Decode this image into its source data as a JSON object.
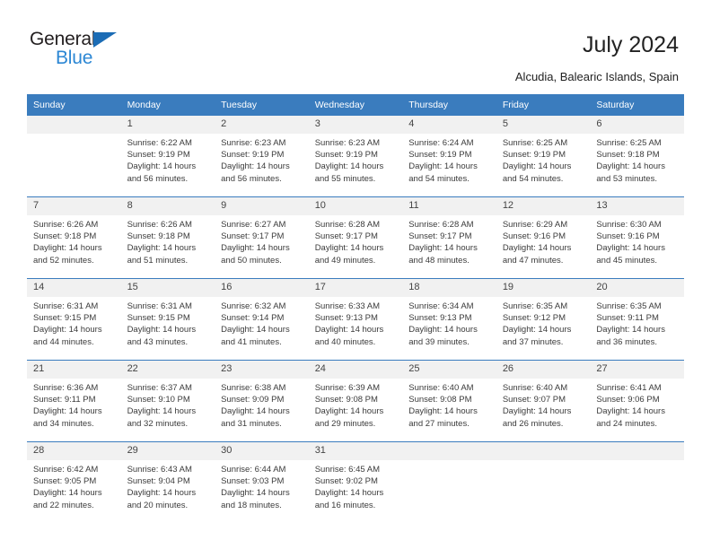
{
  "brand": {
    "name_part1": "General",
    "name_part2": "Blue",
    "accent_color": "#2c87d4",
    "triangle_color": "#1b6cb5"
  },
  "header": {
    "title": "July 2024",
    "location": "Alcudia, Balearic Islands, Spain"
  },
  "calendar": {
    "header_bg": "#3a7cbe",
    "daynum_bg": "#f1f1f1",
    "weekdays": [
      "Sunday",
      "Monday",
      "Tuesday",
      "Wednesday",
      "Thursday",
      "Friday",
      "Saturday"
    ],
    "labels": {
      "sunrise": "Sunrise:",
      "sunset": "Sunset:",
      "daylight": "Daylight:"
    },
    "weeks": [
      [
        {
          "day": "",
          "sunrise": "",
          "sunset": "",
          "daylight_line1": "",
          "daylight_line2": ""
        },
        {
          "day": "1",
          "sunrise": "Sunrise: 6:22 AM",
          "sunset": "Sunset: 9:19 PM",
          "daylight_line1": "Daylight: 14 hours",
          "daylight_line2": "and 56 minutes."
        },
        {
          "day": "2",
          "sunrise": "Sunrise: 6:23 AM",
          "sunset": "Sunset: 9:19 PM",
          "daylight_line1": "Daylight: 14 hours",
          "daylight_line2": "and 56 minutes."
        },
        {
          "day": "3",
          "sunrise": "Sunrise: 6:23 AM",
          "sunset": "Sunset: 9:19 PM",
          "daylight_line1": "Daylight: 14 hours",
          "daylight_line2": "and 55 minutes."
        },
        {
          "day": "4",
          "sunrise": "Sunrise: 6:24 AM",
          "sunset": "Sunset: 9:19 PM",
          "daylight_line1": "Daylight: 14 hours",
          "daylight_line2": "and 54 minutes."
        },
        {
          "day": "5",
          "sunrise": "Sunrise: 6:25 AM",
          "sunset": "Sunset: 9:19 PM",
          "daylight_line1": "Daylight: 14 hours",
          "daylight_line2": "and 54 minutes."
        },
        {
          "day": "6",
          "sunrise": "Sunrise: 6:25 AM",
          "sunset": "Sunset: 9:18 PM",
          "daylight_line1": "Daylight: 14 hours",
          "daylight_line2": "and 53 minutes."
        }
      ],
      [
        {
          "day": "7",
          "sunrise": "Sunrise: 6:26 AM",
          "sunset": "Sunset: 9:18 PM",
          "daylight_line1": "Daylight: 14 hours",
          "daylight_line2": "and 52 minutes."
        },
        {
          "day": "8",
          "sunrise": "Sunrise: 6:26 AM",
          "sunset": "Sunset: 9:18 PM",
          "daylight_line1": "Daylight: 14 hours",
          "daylight_line2": "and 51 minutes."
        },
        {
          "day": "9",
          "sunrise": "Sunrise: 6:27 AM",
          "sunset": "Sunset: 9:17 PM",
          "daylight_line1": "Daylight: 14 hours",
          "daylight_line2": "and 50 minutes."
        },
        {
          "day": "10",
          "sunrise": "Sunrise: 6:28 AM",
          "sunset": "Sunset: 9:17 PM",
          "daylight_line1": "Daylight: 14 hours",
          "daylight_line2": "and 49 minutes."
        },
        {
          "day": "11",
          "sunrise": "Sunrise: 6:28 AM",
          "sunset": "Sunset: 9:17 PM",
          "daylight_line1": "Daylight: 14 hours",
          "daylight_line2": "and 48 minutes."
        },
        {
          "day": "12",
          "sunrise": "Sunrise: 6:29 AM",
          "sunset": "Sunset: 9:16 PM",
          "daylight_line1": "Daylight: 14 hours",
          "daylight_line2": "and 47 minutes."
        },
        {
          "day": "13",
          "sunrise": "Sunrise: 6:30 AM",
          "sunset": "Sunset: 9:16 PM",
          "daylight_line1": "Daylight: 14 hours",
          "daylight_line2": "and 45 minutes."
        }
      ],
      [
        {
          "day": "14",
          "sunrise": "Sunrise: 6:31 AM",
          "sunset": "Sunset: 9:15 PM",
          "daylight_line1": "Daylight: 14 hours",
          "daylight_line2": "and 44 minutes."
        },
        {
          "day": "15",
          "sunrise": "Sunrise: 6:31 AM",
          "sunset": "Sunset: 9:15 PM",
          "daylight_line1": "Daylight: 14 hours",
          "daylight_line2": "and 43 minutes."
        },
        {
          "day": "16",
          "sunrise": "Sunrise: 6:32 AM",
          "sunset": "Sunset: 9:14 PM",
          "daylight_line1": "Daylight: 14 hours",
          "daylight_line2": "and 41 minutes."
        },
        {
          "day": "17",
          "sunrise": "Sunrise: 6:33 AM",
          "sunset": "Sunset: 9:13 PM",
          "daylight_line1": "Daylight: 14 hours",
          "daylight_line2": "and 40 minutes."
        },
        {
          "day": "18",
          "sunrise": "Sunrise: 6:34 AM",
          "sunset": "Sunset: 9:13 PM",
          "daylight_line1": "Daylight: 14 hours",
          "daylight_line2": "and 39 minutes."
        },
        {
          "day": "19",
          "sunrise": "Sunrise: 6:35 AM",
          "sunset": "Sunset: 9:12 PM",
          "daylight_line1": "Daylight: 14 hours",
          "daylight_line2": "and 37 minutes."
        },
        {
          "day": "20",
          "sunrise": "Sunrise: 6:35 AM",
          "sunset": "Sunset: 9:11 PM",
          "daylight_line1": "Daylight: 14 hours",
          "daylight_line2": "and 36 minutes."
        }
      ],
      [
        {
          "day": "21",
          "sunrise": "Sunrise: 6:36 AM",
          "sunset": "Sunset: 9:11 PM",
          "daylight_line1": "Daylight: 14 hours",
          "daylight_line2": "and 34 minutes."
        },
        {
          "day": "22",
          "sunrise": "Sunrise: 6:37 AM",
          "sunset": "Sunset: 9:10 PM",
          "daylight_line1": "Daylight: 14 hours",
          "daylight_line2": "and 32 minutes."
        },
        {
          "day": "23",
          "sunrise": "Sunrise: 6:38 AM",
          "sunset": "Sunset: 9:09 PM",
          "daylight_line1": "Daylight: 14 hours",
          "daylight_line2": "and 31 minutes."
        },
        {
          "day": "24",
          "sunrise": "Sunrise: 6:39 AM",
          "sunset": "Sunset: 9:08 PM",
          "daylight_line1": "Daylight: 14 hours",
          "daylight_line2": "and 29 minutes."
        },
        {
          "day": "25",
          "sunrise": "Sunrise: 6:40 AM",
          "sunset": "Sunset: 9:08 PM",
          "daylight_line1": "Daylight: 14 hours",
          "daylight_line2": "and 27 minutes."
        },
        {
          "day": "26",
          "sunrise": "Sunrise: 6:40 AM",
          "sunset": "Sunset: 9:07 PM",
          "daylight_line1": "Daylight: 14 hours",
          "daylight_line2": "and 26 minutes."
        },
        {
          "day": "27",
          "sunrise": "Sunrise: 6:41 AM",
          "sunset": "Sunset: 9:06 PM",
          "daylight_line1": "Daylight: 14 hours",
          "daylight_line2": "and 24 minutes."
        }
      ],
      [
        {
          "day": "28",
          "sunrise": "Sunrise: 6:42 AM",
          "sunset": "Sunset: 9:05 PM",
          "daylight_line1": "Daylight: 14 hours",
          "daylight_line2": "and 22 minutes."
        },
        {
          "day": "29",
          "sunrise": "Sunrise: 6:43 AM",
          "sunset": "Sunset: 9:04 PM",
          "daylight_line1": "Daylight: 14 hours",
          "daylight_line2": "and 20 minutes."
        },
        {
          "day": "30",
          "sunrise": "Sunrise: 6:44 AM",
          "sunset": "Sunset: 9:03 PM",
          "daylight_line1": "Daylight: 14 hours",
          "daylight_line2": "and 18 minutes."
        },
        {
          "day": "31",
          "sunrise": "Sunrise: 6:45 AM",
          "sunset": "Sunset: 9:02 PM",
          "daylight_line1": "Daylight: 14 hours",
          "daylight_line2": "and 16 minutes."
        },
        {
          "day": "",
          "sunrise": "",
          "sunset": "",
          "daylight_line1": "",
          "daylight_line2": ""
        },
        {
          "day": "",
          "sunrise": "",
          "sunset": "",
          "daylight_line1": "",
          "daylight_line2": ""
        },
        {
          "day": "",
          "sunrise": "",
          "sunset": "",
          "daylight_line1": "",
          "daylight_line2": ""
        }
      ]
    ]
  }
}
